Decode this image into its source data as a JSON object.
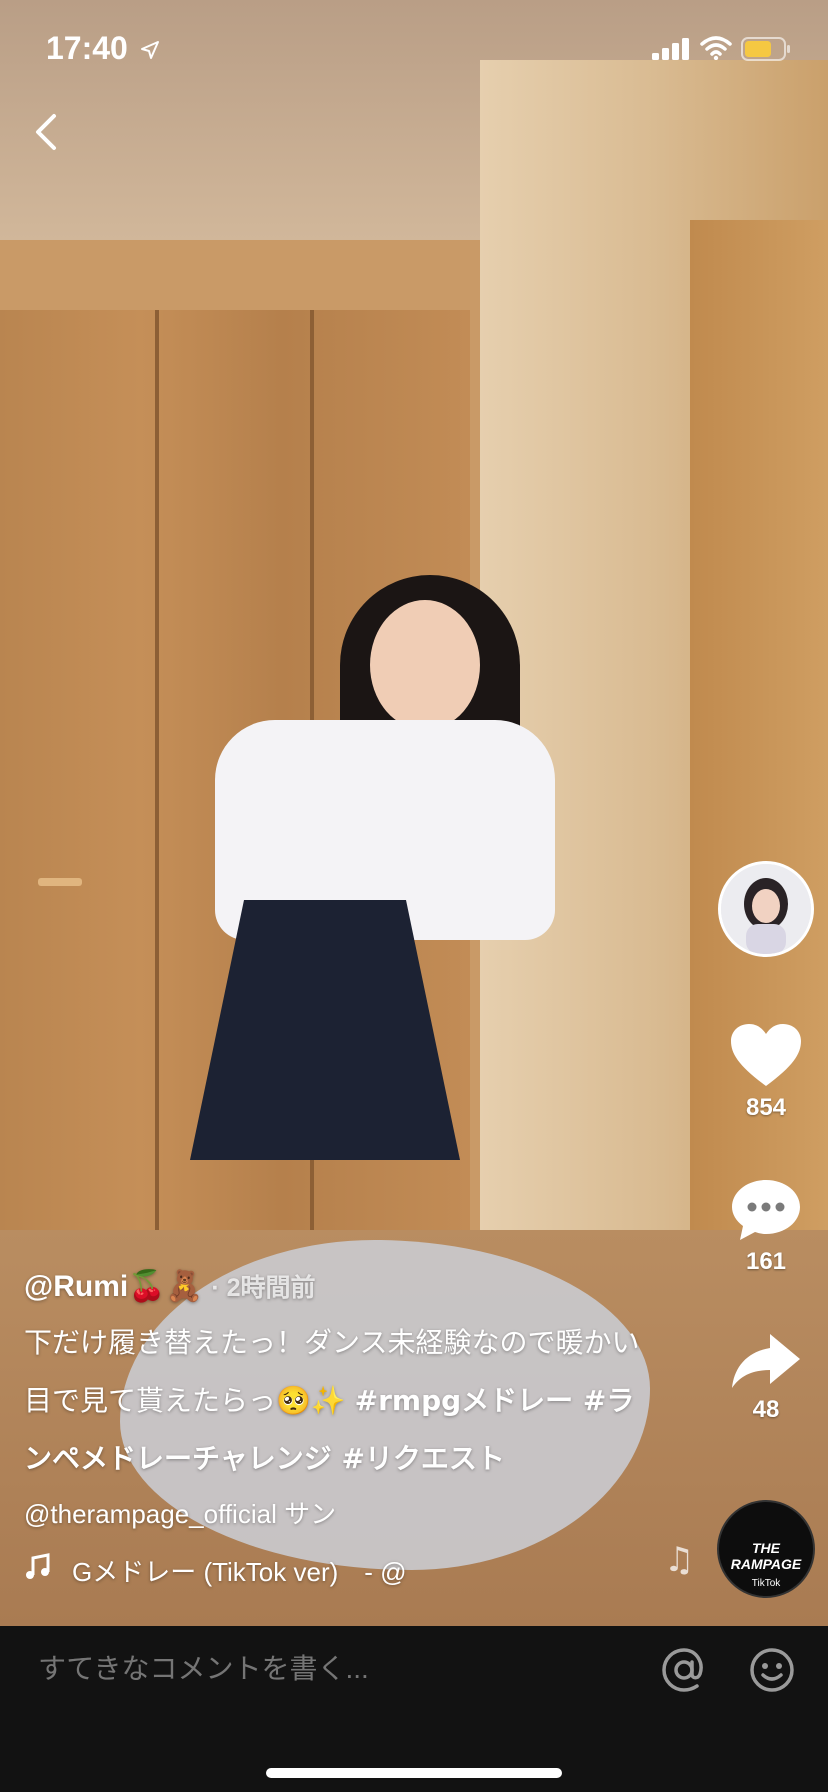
{
  "status_bar": {
    "time": "17:40",
    "icons": [
      "location-arrow-icon",
      "signal-icon",
      "wifi-icon",
      "battery-icon"
    ],
    "battery_color": "#f5c842"
  },
  "nav": {
    "back_icon": "chevron-left-icon"
  },
  "actions": {
    "likes": "854",
    "comments": "161",
    "shares": "48"
  },
  "caption": {
    "author": "@Rumi🍒🧸",
    "time_ago": "· 2時間前",
    "text": "下だけ履き替えたっ！ダンス未経験なので暖かい目で見て貰えたらっ🥺✨",
    "hashtags": "#rmpgメドレー #ランペメドレーチャレンジ #リクエスト",
    "mention": "@therampage_official サン"
  },
  "music": {
    "title": "Gメドレー (TikTok ver)　- @"
  },
  "sound_disc": {
    "label": "THE RAMPAGE",
    "sub": "TikTok"
  },
  "comment_bar": {
    "placeholder": "すてきなコメントを書く..."
  }
}
